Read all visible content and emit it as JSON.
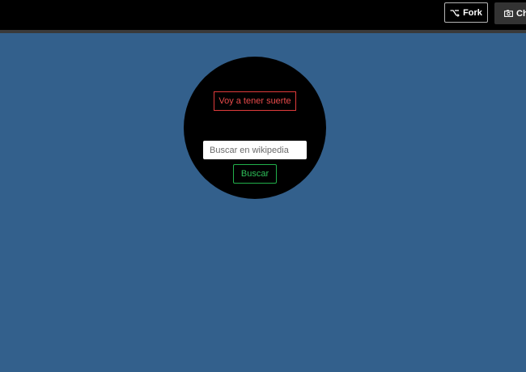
{
  "toolbar": {
    "fork_label": "Fork",
    "fork_icon": "fork-icon",
    "change_label": "Ch",
    "change_icon": "camera-icon"
  },
  "main": {
    "lucky_label": "Voy a tener suerte",
    "search_placeholder": "Buscar en wikipedia",
    "search_value": "",
    "search_button_label": "Buscar"
  },
  "colors": {
    "background": "#33608c",
    "topbar": "#000000",
    "circle": "#000000",
    "lucky_accent": "#e84a4a",
    "search_accent": "#2fc05a"
  }
}
